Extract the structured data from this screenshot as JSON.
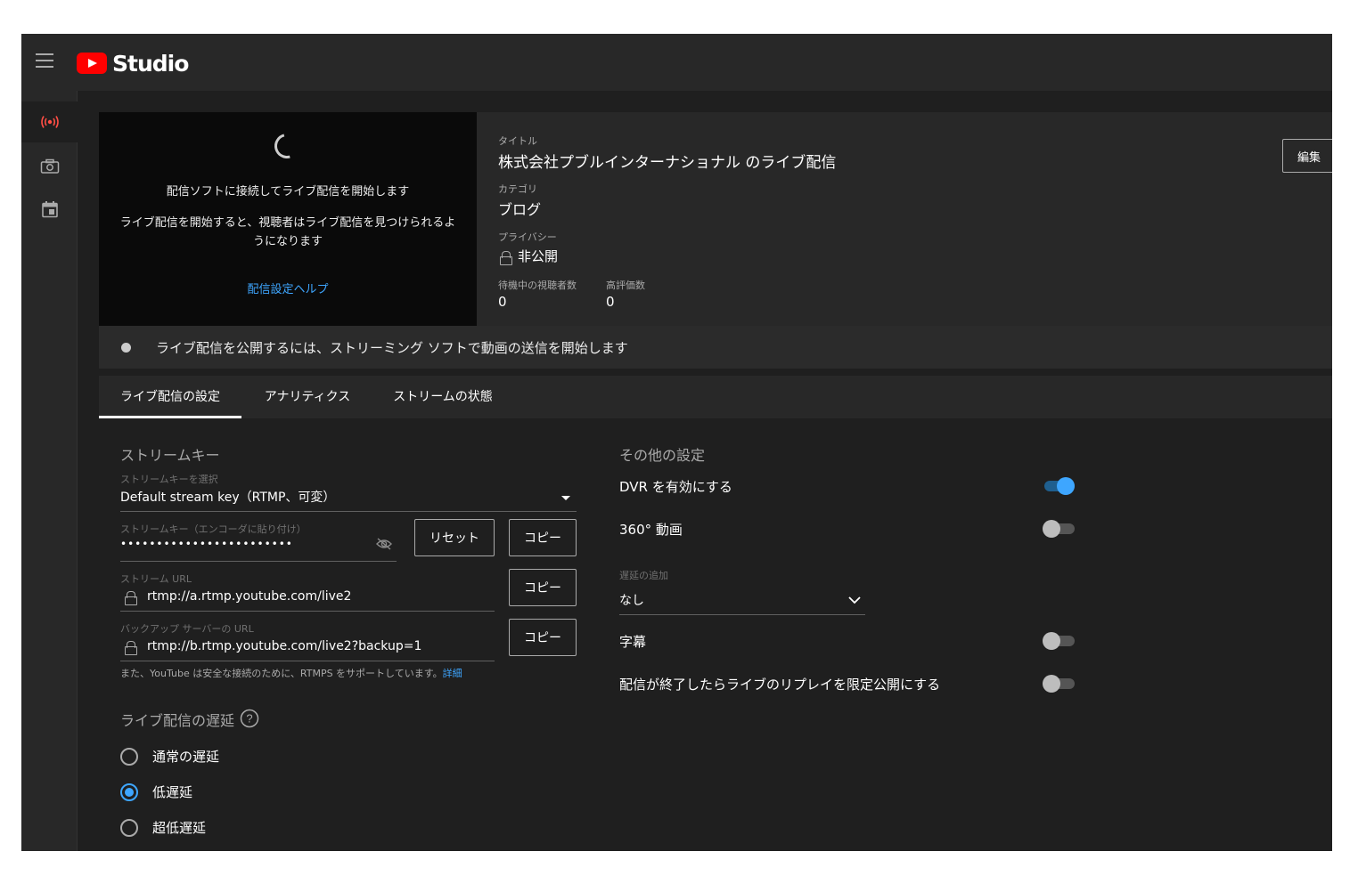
{
  "app": {
    "logo_text": "Studio"
  },
  "rail": {
    "items": [
      "live-icon",
      "camera-icon",
      "calendar-icon"
    ]
  },
  "preview": {
    "message": "配信ソフトに接続してライブ配信を開始します",
    "sub": "ライブ配信を開始すると、視聴者はライブ配信を見つけられるようになります",
    "help_link": "配信設定ヘルプ"
  },
  "info": {
    "title_label": "タイトル",
    "title": "株式会社プブルインターナショナル のライブ配信",
    "category_label": "カテゴリ",
    "category": "ブログ",
    "privacy_label": "プライバシー",
    "privacy": "非公開",
    "viewers_label": "待機中の視聴者数",
    "viewers": "0",
    "likes_label": "高評価数",
    "likes": "0",
    "edit": "編集"
  },
  "status": {
    "text": "ライブ配信を公開するには、ストリーミング ソフトで動画の送信を開始します"
  },
  "tabs": [
    {
      "label": "ライブ配信の設定",
      "active": true
    },
    {
      "label": "アナリティクス",
      "active": false
    },
    {
      "label": "ストリームの状態",
      "active": false
    }
  ],
  "stream": {
    "section_title": "ストリームキー",
    "select_label": "ストリームキーを選択",
    "select_value": "Default stream key（RTMP、可変）",
    "key_label": "ストリームキー（エンコーダに貼り付け）",
    "key_value": "••••••••••••••••••••••••",
    "reset": "リセット",
    "copy": "コピー",
    "url_label": "ストリーム URL",
    "url_value": "rtmp://a.rtmp.youtube.com/live2",
    "backup_label": "バックアップ サーバーの URL",
    "backup_value": "rtmp://b.rtmp.youtube.com/live2?backup=1",
    "note": "また、YouTube は安全な接続のために、RTMPS をサポートしています。",
    "note_link": "詳細"
  },
  "latency": {
    "title": "ライブ配信の遅延",
    "options": [
      {
        "label": "通常の遅延",
        "selected": false
      },
      {
        "label": "低遅延",
        "selected": true
      },
      {
        "label": "超低遅延",
        "selected": false
      }
    ]
  },
  "other": {
    "title": "その他の設定",
    "dvr": {
      "label": "DVR を有効にする",
      "on": true
    },
    "video360": {
      "label": "360° 動画",
      "on": false
    },
    "delay_label": "遅延の追加",
    "delay_value": "なし",
    "captions": {
      "label": "字幕",
      "on": false
    },
    "replay": {
      "label": "配信が終了したらライブのリプレイを限定公開にする",
      "on": false
    }
  }
}
